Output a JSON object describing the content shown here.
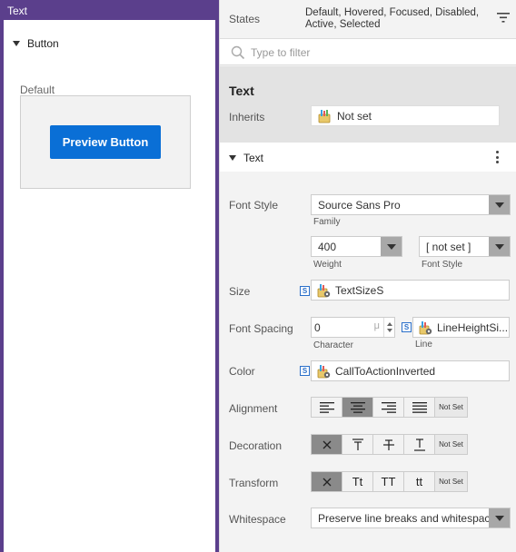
{
  "left": {
    "title": "Text",
    "tree_item": "Button",
    "preview_label": "Default",
    "preview_button": "Preview Button"
  },
  "right": {
    "states_label": "States",
    "states_value": "Default, Hovered, Focused, Disabled, Active, Selected",
    "filter_placeholder": "Type to filter",
    "section_title": "Text",
    "inherits_label": "Inherits",
    "inherits_value": "Not set",
    "group_title": "Text",
    "font_style": {
      "label": "Font Style",
      "family": "Source Sans Pro",
      "family_label": "Family",
      "weight": "400",
      "weight_label": "Weight",
      "style": "[ not set ]",
      "style_label": "Font Style"
    },
    "size": {
      "label": "Size",
      "value": "TextSizeS"
    },
    "spacing": {
      "label": "Font Spacing",
      "character": "0",
      "unit": "μ",
      "character_label": "Character",
      "line": "LineHeightSi...",
      "line_label": "Line"
    },
    "color": {
      "label": "Color",
      "value": "CallToActionInverted"
    },
    "alignment": {
      "label": "Alignment",
      "not_set": "Not Set"
    },
    "decoration": {
      "label": "Decoration",
      "not_set": "Not Set"
    },
    "transform": {
      "label": "Transform",
      "options": [
        "Tt",
        "TT",
        "tt"
      ],
      "not_set": "Not Set"
    },
    "whitespace": {
      "label": "Whitespace",
      "value": "Preserve line breaks and whitespace"
    }
  },
  "colors": {
    "frame": "#5b3f8c",
    "accent_button": "#0a6fd6",
    "selected_segment": "#8a8a8a"
  }
}
